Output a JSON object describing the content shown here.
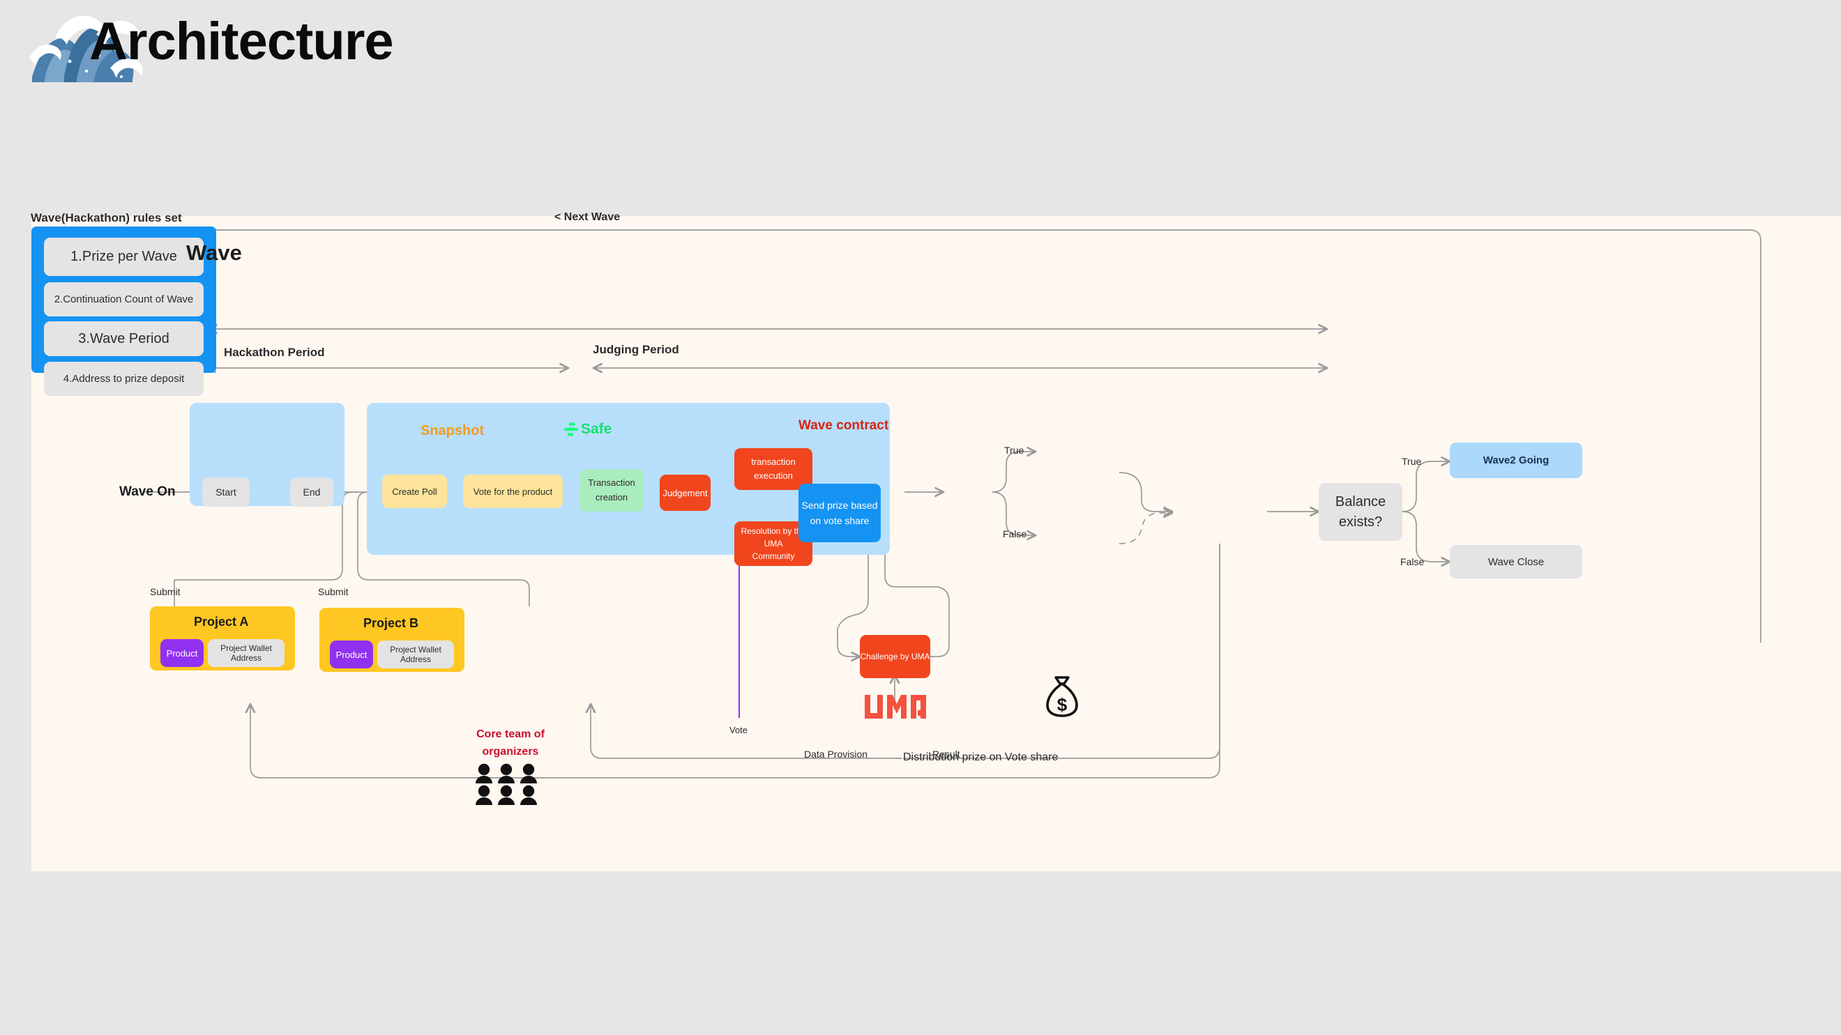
{
  "header": {
    "title": "Architecture",
    "logo_icon": "wave-icon"
  },
  "canvas": {
    "background": "#fef8f1",
    "page_background": "#e7e6e6"
  },
  "diagram": {
    "rules_panel": {
      "heading": "Wave(Hackathon)  rules set",
      "accent_color": "#1593f2",
      "items": [
        {
          "label": "1.Prize per Wave"
        },
        {
          "label": "2.Continuation Count of Wave"
        },
        {
          "label": "3.Wave Period"
        },
        {
          "label": "4.Address to prize deposit"
        }
      ]
    },
    "timeline": {
      "next_wave_label": "< Next Wave",
      "wave_title": "Wave",
      "hackathon_period_label": "Hackathon Period",
      "judging_period_label": "Judging Period"
    },
    "entry": {
      "wave_on_label": "Wave On"
    },
    "hackathon_nodes": [
      {
        "label": "Start"
      },
      {
        "label": "End"
      }
    ],
    "judging": {
      "snapshot_label": "Snapshot",
      "snapshot_color": "#f59a1e",
      "safe_label": "Safe",
      "safe_color": "#14e06e",
      "wave_contract_label": "Wave  contract",
      "wave_contract_color": "#d72410",
      "nodes": [
        {
          "label": "Create Poll"
        },
        {
          "label": "Vote for the product"
        },
        {
          "label": "Transaction\ncreation"
        },
        {
          "label": "Judgement"
        },
        {
          "label": "transaction\nexecution"
        },
        {
          "label": "Resolution by the UMA\nCommunity"
        },
        {
          "label": "Send prize based\non vote share"
        }
      ],
      "branch_true_label": "True",
      "branch_false_label": "False",
      "vote_label": "Vote",
      "data_provision_label": "Data Provision",
      "result_label": "Result"
    },
    "balance": {
      "question_label": "Balance\nexists?",
      "true_label": "True",
      "false_label": "False",
      "wave2_going_label": "Wave2 Going",
      "wave_close_label": "Wave Close"
    },
    "projects": [
      {
        "title": "Project A",
        "product_label": "Product",
        "wallet_label": "Project Wallet Address",
        "submit_label": "Submit"
      },
      {
        "title": "Project B",
        "product_label": "Product",
        "wallet_label": "Project Wallet Address",
        "submit_label": "Submit"
      }
    ],
    "core_team": {
      "label_line1": "Core team of",
      "label_line2": "organizers",
      "color": "#c8102e",
      "people_icon": "people-group-icon"
    },
    "uma": {
      "challenge_label": "Challenge by UMA",
      "logo_text": "UMA",
      "logo_color": "#f4513f"
    },
    "distribution": {
      "label": "Distribution prize on Vote share",
      "money_icon": "money-bag-icon"
    }
  }
}
